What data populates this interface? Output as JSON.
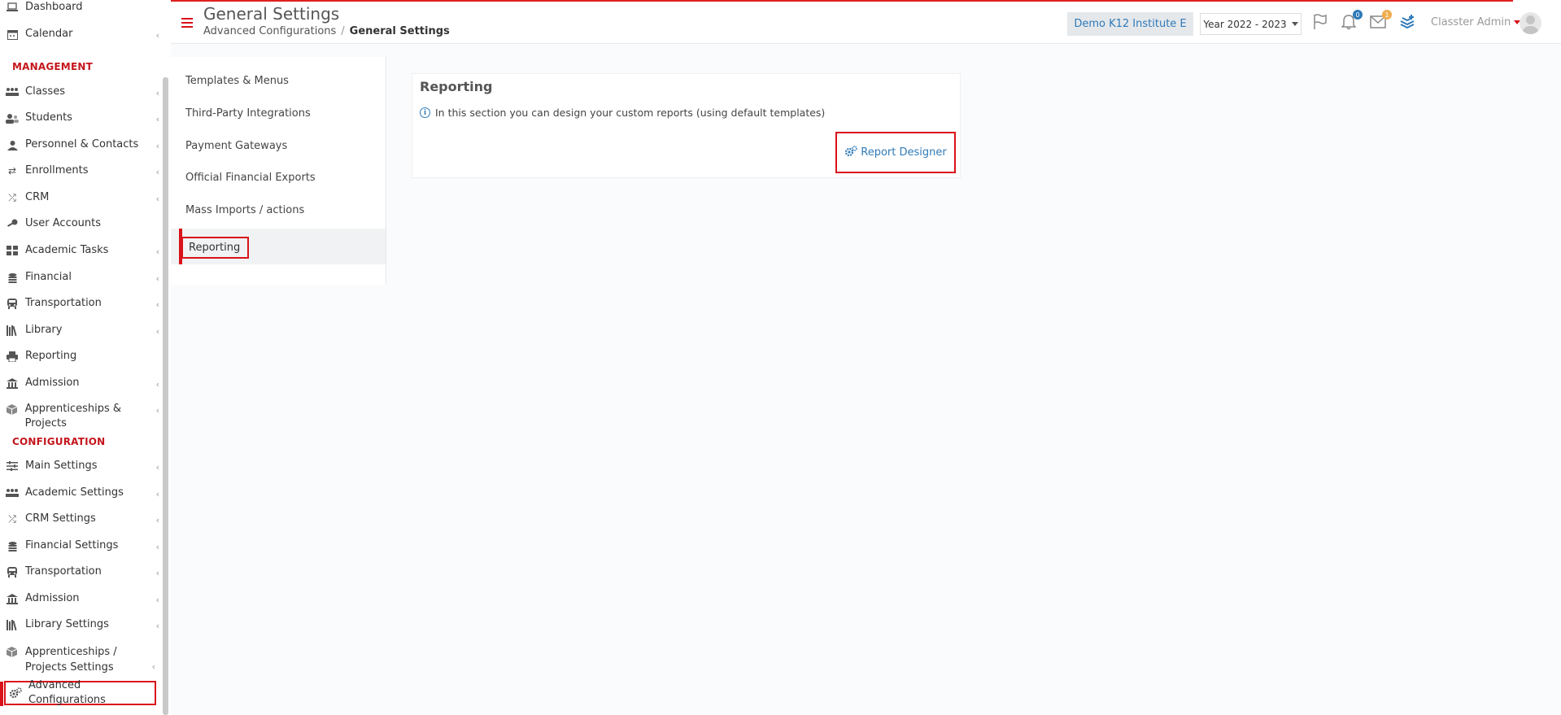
{
  "sidebar": {
    "top_items": [
      {
        "label": "Dashboard",
        "icon": "laptop-icon"
      },
      {
        "label": "Calendar",
        "icon": "calendar-icon"
      }
    ],
    "management_heading": "MANAGEMENT",
    "management_items": [
      {
        "label": "Classes",
        "icon": "classes-icon"
      },
      {
        "label": "Students",
        "icon": "students-icon"
      },
      {
        "label": "Personnel & Contacts",
        "icon": "personnel-icon"
      },
      {
        "label": "Enrollments",
        "icon": "enrollments-icon"
      },
      {
        "label": "CRM",
        "icon": "crm-icon"
      },
      {
        "label": "User Accounts",
        "icon": "key-icon"
      },
      {
        "label": "Academic Tasks",
        "icon": "tasks-icon"
      },
      {
        "label": "Financial",
        "icon": "coins-icon"
      },
      {
        "label": "Transportation",
        "icon": "bus-icon"
      },
      {
        "label": "Library",
        "icon": "library-icon"
      },
      {
        "label": "Reporting",
        "icon": "printer-icon"
      },
      {
        "label": "Admission",
        "icon": "institution-icon"
      },
      {
        "label": "Apprenticeships & Projects",
        "icon": "box-icon"
      }
    ],
    "configuration_heading": "CONFIGURATION",
    "configuration_items": [
      {
        "label": "Main Settings",
        "icon": "sliders-icon"
      },
      {
        "label": "Academic Settings",
        "icon": "classes-icon"
      },
      {
        "label": "CRM Settings",
        "icon": "crm-icon"
      },
      {
        "label": "Financial Settings",
        "icon": "coins-icon"
      },
      {
        "label": "Transportation",
        "icon": "bus-icon"
      },
      {
        "label": "Admission",
        "icon": "institution-icon"
      },
      {
        "label": "Library Settings",
        "icon": "library-icon"
      },
      {
        "label": "Apprenticeships / Projects Settings",
        "icon": "box-icon"
      },
      {
        "label": "Advanced Configurations",
        "icon": "gears-icon"
      }
    ]
  },
  "header": {
    "title": "General Settings",
    "breadcrumb": [
      "Advanced Configurations",
      "General Settings"
    ],
    "breadcrumb_sep": "/",
    "institute": "Demo K12 Institute E",
    "year": "Year 2022 - 2023",
    "notifications_count": "0",
    "messages_count": "1",
    "user_name": "Classter Admin"
  },
  "submenu": {
    "items": [
      "Templates & Menus",
      "Third-Party Integrations",
      "Payment Gateways",
      "Official Financial Exports",
      "Mass Imports / actions",
      "Reporting"
    ]
  },
  "main": {
    "card_title": "Reporting",
    "info_text": "In this section you can design your custom reports (using default templates)",
    "info_icon": "i",
    "button_label": "Report Designer"
  },
  "colors": {
    "accent_red": "#d9121a",
    "link_blue": "#2f7ab8"
  }
}
